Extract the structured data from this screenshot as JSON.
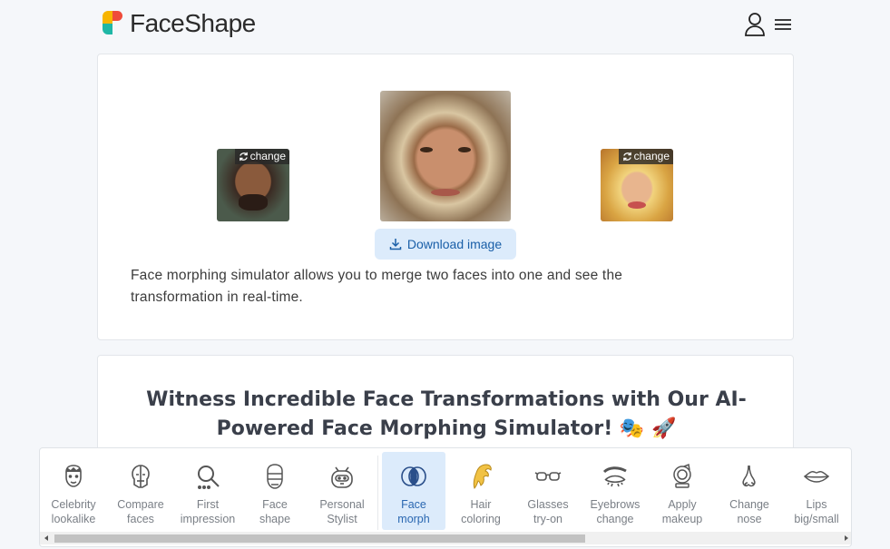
{
  "brand": {
    "name": "FaceShape"
  },
  "header": {
    "icons": [
      "user-icon",
      "menu-icon"
    ]
  },
  "morph_card": {
    "change_label": "change",
    "download_label": "Download image",
    "description": "Face morphing simulator allows you to merge two faces into one and see the transformation in real-time."
  },
  "info_card": {
    "headline": "Witness Incredible Face Transformations with Our AI-Powered Face Morphing Simulator! 🎭 🚀"
  },
  "toolbar": {
    "tools": [
      {
        "label": "Celebrity\nlookalike",
        "icon": "celebrity-face-icon"
      },
      {
        "label": "Compare\nfaces",
        "icon": "compare-faces-icon"
      },
      {
        "label": "First\nimpression",
        "icon": "magnifier-icon"
      },
      {
        "label": "Face\nshape",
        "icon": "face-shape-icon"
      },
      {
        "label": "Personal\nStylist",
        "icon": "robot-stylist-icon"
      },
      {
        "label": "Face\nmorph",
        "icon": "face-morph-icon",
        "active": true
      },
      {
        "label": "Hair\ncoloring",
        "icon": "hair-icon"
      },
      {
        "label": "Glasses\ntry-on",
        "icon": "glasses-icon"
      },
      {
        "label": "Eyebrows\nchange",
        "icon": "eyebrows-icon"
      },
      {
        "label": "Apply\nmakeup",
        "icon": "makeup-icon"
      },
      {
        "label": "Change\nnose",
        "icon": "nose-icon"
      },
      {
        "label": "Lips\nbig/small",
        "icon": "lips-icon"
      }
    ]
  },
  "colors": {
    "accent_bg": "#dcebfb",
    "accent_text": "#1a5fa8"
  }
}
